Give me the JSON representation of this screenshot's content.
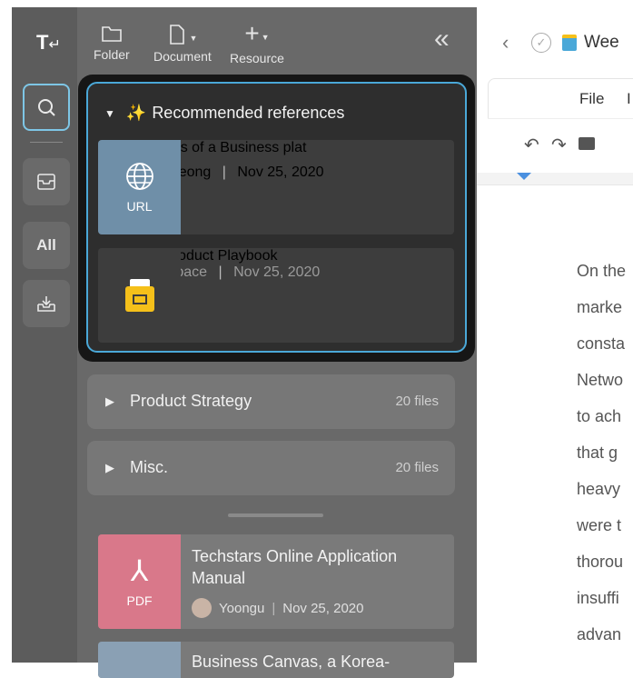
{
  "rail": {
    "logo": "T",
    "all_label": "All"
  },
  "toolbar": {
    "folder_label": "Folder",
    "document_label": "Document",
    "resource_label": "Resource"
  },
  "recommended": {
    "title": "Recommended references",
    "items": [
      {
        "type_label": "URL",
        "title": "The Elements of a Business plat",
        "author": "Diana Jeong",
        "date": "Nov 25, 2020"
      },
      {
        "title": "The Lean Product Playbook",
        "author": "Go to workspace",
        "date": "Nov 25, 2020"
      }
    ]
  },
  "sections": [
    {
      "name": "Product Strategy",
      "count": "20 files"
    },
    {
      "name": "Misc.",
      "count": "20 files"
    }
  ],
  "files": [
    {
      "type_label": "PDF",
      "title": "Techstars Online Application Manual",
      "author": "Yoongu",
      "date": "Nov 25, 2020"
    },
    {
      "title": "Business Canvas, a Korea-"
    }
  ],
  "doc": {
    "title": "Wee",
    "menu_file": "File",
    "menu_edit": "I",
    "lines": [
      "On the",
      "marke",
      "consta",
      "Netwo",
      "to ach",
      "that g",
      "heavy",
      "were t",
      "thorou",
      "insuffi",
      "advan"
    ]
  },
  "colors": {
    "accent": "#4aa8d8",
    "url_thumb": "#6f8fa8",
    "pdf_thumb": "#d9788a",
    "folder_yellow": "#f5c01a"
  }
}
